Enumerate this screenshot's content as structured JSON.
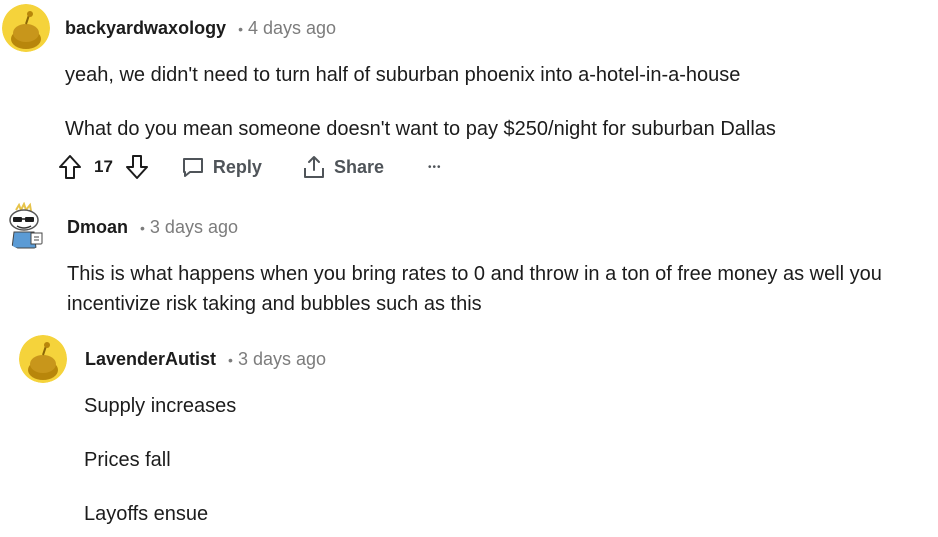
{
  "comments": [
    {
      "username": "backyardwaxology",
      "time": "4 days ago",
      "paragraphs": [
        "yeah, we didn't need to turn half of suburban phoenix into a-hotel-in-a-house",
        "What do you mean someone doesn't want to pay $250/night for suburban Dallas"
      ],
      "votes": "17",
      "reply_label": "Reply",
      "share_label": "Share",
      "more_label": "•••"
    },
    {
      "username": "Dmoan",
      "time": "3 days ago",
      "paragraphs": [
        "This is what happens when you bring rates to 0 and throw in a ton of free money as well you",
        "incentivize risk taking and bubbles such as this"
      ]
    },
    {
      "username": "LavenderAutist",
      "time": "3 days ago",
      "paragraphs": [
        "Supply increases",
        "Prices fall",
        "Layoffs ensue"
      ]
    }
  ],
  "separator": "•",
  "colors": {
    "avatar_bg": "#f5d33b",
    "snoo": "#b8860b",
    "muted": "#7c7c7c",
    "action": "#4f5459"
  }
}
